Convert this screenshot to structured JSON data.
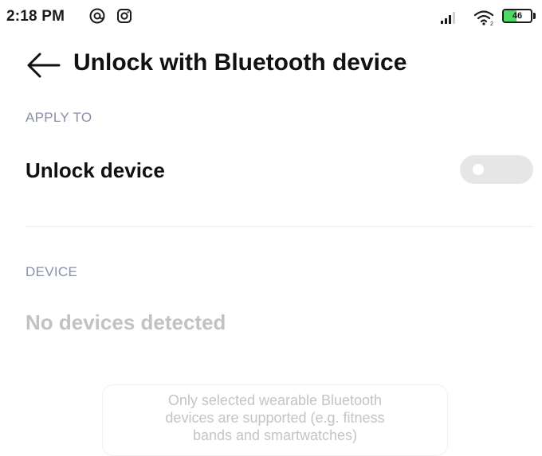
{
  "status_bar": {
    "time": "2:18 PM",
    "left_icons": [
      "at-sign-icon",
      "instagram-icon"
    ],
    "battery_level": 46,
    "battery_label": "46",
    "icons": [
      "signal-icon",
      "wifi-icon",
      "battery-icon"
    ]
  },
  "header": {
    "back_icon": "arrow-left-icon",
    "title": "Unlock with Bluetooth device"
  },
  "apply_section": {
    "label": "APPLY TO",
    "item_label": "Unlock device",
    "toggle_on": false
  },
  "device_section": {
    "label": "DEVICE",
    "empty_text": "No devices detected"
  },
  "info_card": {
    "lines": [
      "Only selected wearable Bluetooth",
      "devices are supported (e.g. fitness",
      "bands and smartwatches)"
    ]
  },
  "colors": {
    "section_label": "#8a8fa8",
    "disabled_text": "#c2c2c2",
    "toggle_off": "#e6e6e6",
    "battery_fill": "#4cd964"
  }
}
